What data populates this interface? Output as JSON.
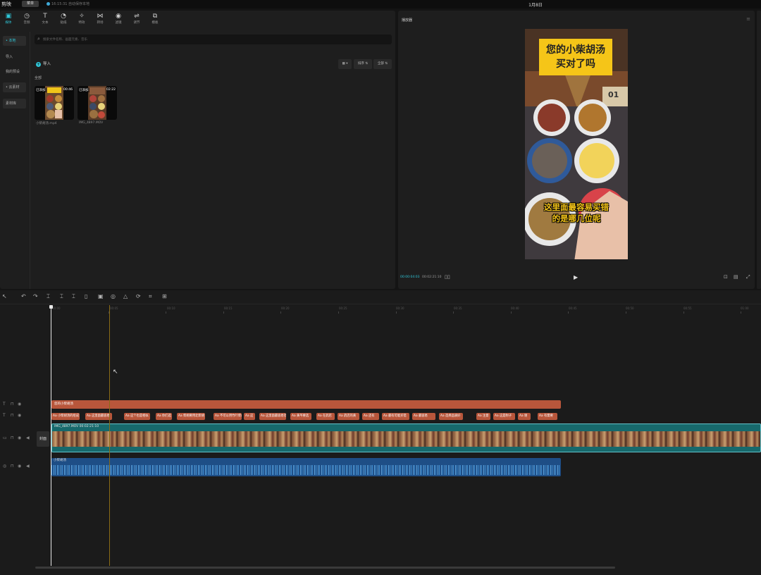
{
  "app": {
    "name": "剪映",
    "menu_label": "菜单",
    "autosave": "16:15:31 自动保存本地",
    "project_title": "1月8日"
  },
  "toolbar": [
    {
      "label": "媒体",
      "icon": "media-icon",
      "glyph": "▣",
      "active": true
    },
    {
      "label": "音频",
      "icon": "audio-icon",
      "glyph": "◷",
      "active": false
    },
    {
      "label": "文本",
      "icon": "text-icon",
      "glyph": "T",
      "active": false
    },
    {
      "label": "贴纸",
      "icon": "sticker-icon",
      "glyph": "◔",
      "active": false
    },
    {
      "label": "特效",
      "icon": "effects-icon",
      "glyph": "✧",
      "active": false
    },
    {
      "label": "转场",
      "icon": "transition-icon",
      "glyph": "⋈",
      "active": false
    },
    {
      "label": "滤镜",
      "icon": "filter-icon",
      "glyph": "◉",
      "active": false
    },
    {
      "label": "调节",
      "icon": "adjust-icon",
      "glyph": "⇌",
      "active": false
    },
    {
      "label": "模板",
      "icon": "template-icon",
      "glyph": "⧉",
      "active": false
    }
  ],
  "left_nav": [
    {
      "label": "• 本地",
      "active": true
    },
    {
      "label": "导入",
      "active": false
    },
    {
      "label": "我的预设",
      "active": false
    },
    {
      "label": "• 云素材",
      "active": false
    },
    {
      "label": "素材库",
      "active": false
    }
  ],
  "search": {
    "placeholder": "搜索文件名称、画面元素、音乐"
  },
  "import_label": "导入",
  "sort_buttons": [
    "▦ ▾",
    "排序 ⇅",
    "全部 ⇅"
  ],
  "section_all": "全部",
  "media_items": [
    {
      "badge": "已添加",
      "duration": "00:46",
      "name": "小柴胡汤.mp4"
    },
    {
      "badge": "已添加",
      "duration": "02:22",
      "name": "IMG_4897.MOV"
    }
  ],
  "player": {
    "title": "播放器",
    "current_time": "00:00:04:03",
    "total_time": "00:02:21:10",
    "video_top_text_line1": "您的小柴胡汤",
    "video_top_text_line2": "买对了吗",
    "video_bottom_text_line1": "这里面最容易买错",
    "video_bottom_text_line2": "的是哪几位呢",
    "calendar_text": "01"
  },
  "timeline": {
    "ruler": [
      "00:00",
      "00:05",
      "00:10",
      "00:15",
      "00:20",
      "00:25",
      "00:30",
      "00:35",
      "00:40",
      "00:45",
      "00:50",
      "00:55",
      "01:00"
    ],
    "text_track_label": "您的小柴胡汤",
    "caption_clips": [
      "Aa 小柴胡汤的组成",
      "Aa 这里面最容易",
      "Aa 这个也是相似",
      "Aa 你们选",
      "Aa 柴胡要用北柴胡",
      "Aa 不可以用竹叶柴胡",
      "Aa 这",
      "Aa 这里面最容易错",
      "Aa 黄芩要选",
      "Aa 在药店",
      "Aa 药店的黄",
      "Aa 还有",
      "Aa 最有可能买错",
      "Aa 最容易",
      "Aa 选择品质好",
      "Aa 注意",
      "Aa 这是附子",
      "Aa 谢",
      "Aa 有需要"
    ],
    "video_clip_label": "IMG_4897.MOV  00:02:21:10",
    "audio_clip_label": "小柴胡汤",
    "cover_label": "封面"
  }
}
